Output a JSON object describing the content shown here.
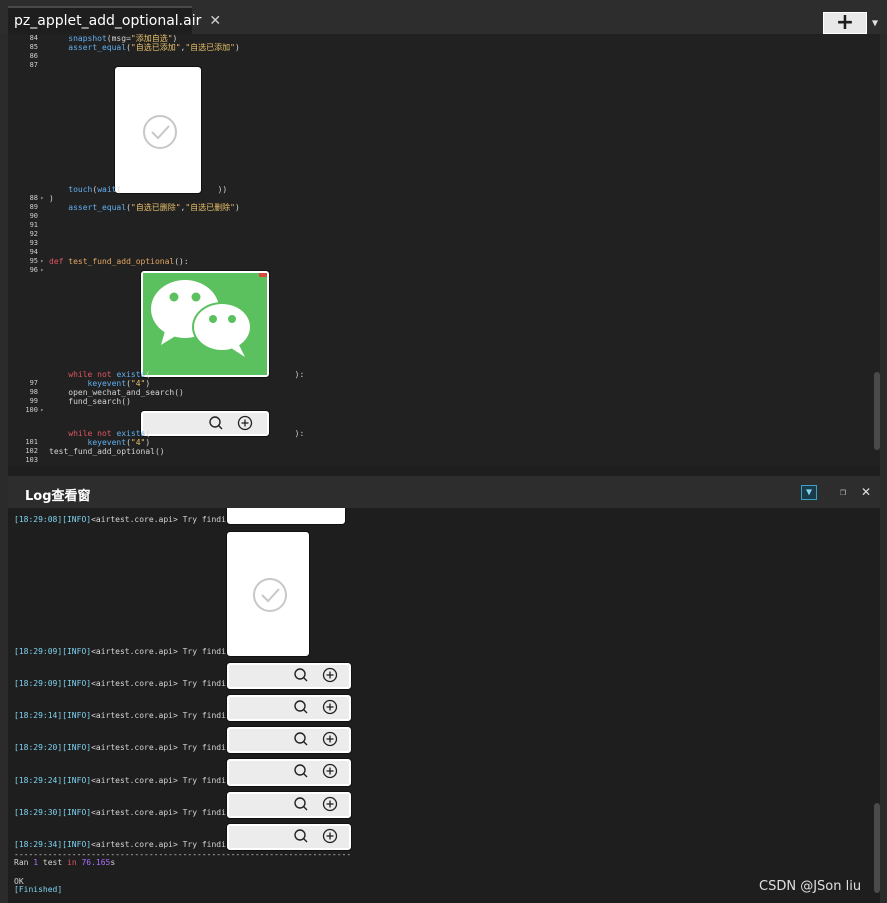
{
  "tabbar": {
    "tab_label": "pz_applet_add_optional.air",
    "close_glyph": "✕",
    "add_glyph": "+",
    "dropdown_glyph": "▼"
  },
  "editor": {
    "lines": [
      {
        "ln": "84",
        "parts": [
          {
            "t": "    "
          },
          {
            "t": "snapshot",
            "c": "fn"
          },
          {
            "t": "(msg="
          },
          {
            "t": "\"添加自选\"",
            "c": "str"
          },
          {
            "t": ")"
          }
        ]
      },
      {
        "ln": "85",
        "parts": [
          {
            "t": "    "
          },
          {
            "t": "assert_equal",
            "c": "fn"
          },
          {
            "t": "("
          },
          {
            "t": "\"自选已添加\"",
            "c": "str"
          },
          {
            "t": ","
          },
          {
            "t": "\"自选已添加\"",
            "c": "str"
          },
          {
            "t": ")"
          }
        ]
      },
      {
        "ln": "86",
        "parts": []
      },
      {
        "ln": "87",
        "parts": []
      },
      {
        "ln": "",
        "parts": [
          {
            "t": "    "
          },
          {
            "t": "touch",
            "c": "fn"
          },
          {
            "t": "("
          },
          {
            "t": "wait",
            "c": "fn"
          },
          {
            "t": "(                    ))"
          }
        ]
      },
      {
        "ln": "88",
        "fold": "▾",
        "parts": [
          {
            "t": ")"
          }
        ]
      },
      {
        "ln": "89",
        "parts": [
          {
            "t": "    "
          },
          {
            "t": "assert_equal",
            "c": "fn"
          },
          {
            "t": "("
          },
          {
            "t": "\"自选已删除\"",
            "c": "str"
          },
          {
            "t": ","
          },
          {
            "t": "\"自选已删除\"",
            "c": "str"
          },
          {
            "t": ")"
          }
        ]
      },
      {
        "ln": "90",
        "parts": []
      },
      {
        "ln": "91",
        "parts": []
      },
      {
        "ln": "92",
        "parts": []
      },
      {
        "ln": "93",
        "parts": []
      },
      {
        "ln": "94",
        "parts": []
      },
      {
        "ln": "95",
        "fold": "▾",
        "parts": [
          {
            "t": "def ",
            "c": "kw"
          },
          {
            "t": "test_fund_add_optional",
            "c": "def"
          },
          {
            "t": "():"
          }
        ]
      },
      {
        "ln": "96",
        "fold": "▾",
        "parts": []
      },
      {
        "ln": "",
        "parts": [
          {
            "t": "    "
          },
          {
            "t": "while not ",
            "c": "kw"
          },
          {
            "t": "exists",
            "c": "fn"
          },
          {
            "t": "(                              ):"
          }
        ]
      },
      {
        "ln": "97",
        "parts": [
          {
            "t": "        "
          },
          {
            "t": "keyevent",
            "c": "fn"
          },
          {
            "t": "("
          },
          {
            "t": "\"4\"",
            "c": "str"
          },
          {
            "t": ")"
          }
        ]
      },
      {
        "ln": "98",
        "parts": [
          {
            "t": "    open_wechat_and_search()"
          }
        ]
      },
      {
        "ln": "99",
        "parts": [
          {
            "t": "    fund_search()"
          }
        ]
      },
      {
        "ln": "100",
        "fold": "▾",
        "parts": []
      },
      {
        "ln": "",
        "parts": [
          {
            "t": "    "
          },
          {
            "t": "while not ",
            "c": "kw"
          },
          {
            "t": "exists",
            "c": "fn"
          },
          {
            "t": "(                              ):"
          }
        ]
      },
      {
        "ln": "101",
        "parts": [
          {
            "t": "        "
          },
          {
            "t": "keyevent",
            "c": "fn"
          },
          {
            "t": "("
          },
          {
            "t": "\"4\"",
            "c": "str"
          },
          {
            "t": ")"
          }
        ]
      },
      {
        "ln": "102",
        "parts": [
          {
            "t": "test_fund_add_optional()"
          }
        ]
      },
      {
        "ln": "103",
        "parts": []
      }
    ]
  },
  "log": {
    "title": "Log查看窗",
    "filter_glyph": "▼",
    "restore_glyph": "❐",
    "close_glyph": "✕",
    "entries": [
      {
        "time": "[18:29:08]",
        "level": "[INFO]",
        "msg": "<airtest.core.api> Try finding:"
      },
      {
        "time": "[18:29:09]",
        "level": "[INFO]",
        "msg": "<airtest.core.api> Try finding:"
      },
      {
        "time": "[18:29:09]",
        "level": "[INFO]",
        "msg": "<airtest.core.api> Try finding:"
      },
      {
        "time": "[18:29:14]",
        "level": "[INFO]",
        "msg": "<airtest.core.api> Try finding:"
      },
      {
        "time": "[18:29:20]",
        "level": "[INFO]",
        "msg": "<airtest.core.api> Try finding:"
      },
      {
        "time": "[18:29:24]",
        "level": "[INFO]",
        "msg": "<airtest.core.api> Try finding:"
      },
      {
        "time": "[18:29:30]",
        "level": "[INFO]",
        "msg": "<airtest.core.api> Try finding:"
      },
      {
        "time": "[18:29:34]",
        "level": "[INFO]",
        "msg": "<airtest.core.api> Try finding:"
      }
    ],
    "separator": "----------------------------------------------------------------------",
    "ran_prefix": "Ran ",
    "ran_count": "1",
    "ran_mid": " test ",
    "ran_in": "in",
    "ran_time": " 76.165",
    "ran_unit": "s",
    "ok": "OK",
    "finished": "[Finished]"
  },
  "watermark": "CSDN @JSon  liu",
  "colors": {
    "keyword": "#e05561",
    "function": "#61afef",
    "string": "#e6c06a",
    "log_time": "#7fd3f0",
    "wechat_green": "#5bc15e"
  },
  "icons": [
    "close-icon",
    "plus-icon",
    "chevron-down-icon",
    "checkmark-circle-icon",
    "wechat-icon",
    "search-icon",
    "add-circle-icon",
    "filter-icon",
    "restore-icon"
  ]
}
